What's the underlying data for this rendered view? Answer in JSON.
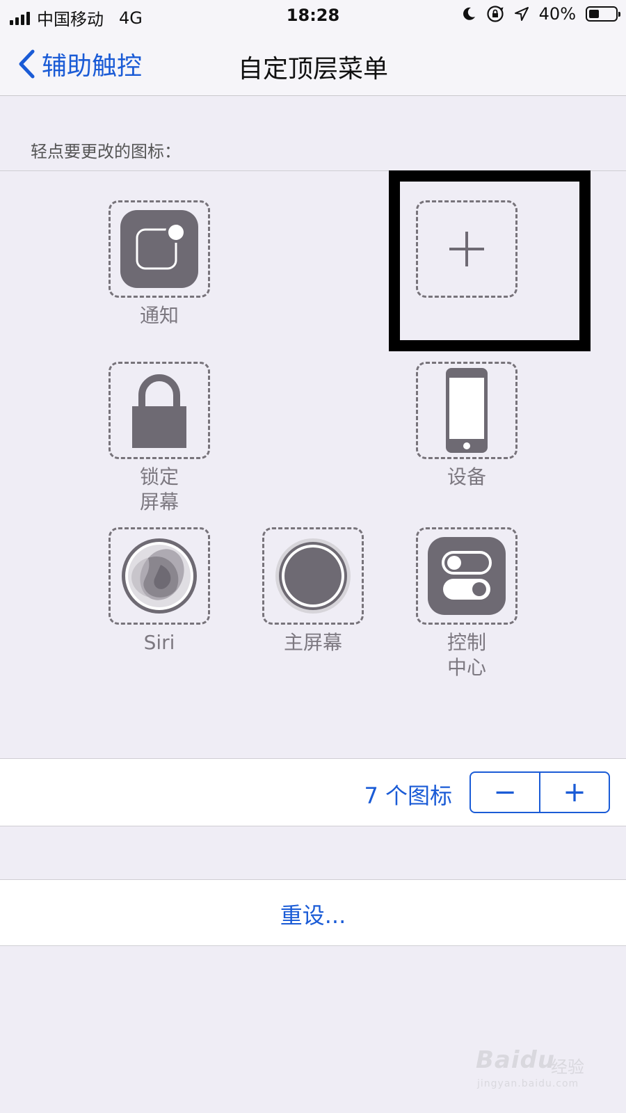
{
  "status_bar": {
    "carrier": "中国移动",
    "network": "4G",
    "time": "18:28",
    "battery_percent": "40%",
    "battery_level": 0.4,
    "icons": [
      "moon-icon",
      "rotation-lock-icon",
      "location-arrow-icon"
    ]
  },
  "nav": {
    "back_label": "辅助触控",
    "title": "自定顶层菜单"
  },
  "section_caption": "轻点要更改的图标：",
  "icons": [
    {
      "label": "通知",
      "icon": "notification-icon"
    },
    {
      "label": "",
      "icon": "plus-icon",
      "highlighted": true
    },
    {
      "label": "锁定\n屏幕",
      "icon": "lock-icon"
    },
    {
      "label": "设备",
      "icon": "device-icon"
    },
    {
      "label": "Siri",
      "icon": "siri-icon"
    },
    {
      "label": "主屏幕",
      "icon": "home-button-icon"
    },
    {
      "label": "控制\n中心",
      "icon": "control-center-icon"
    }
  ],
  "icon_count": {
    "label": "7 个图标",
    "decrement": "−",
    "increment": "+"
  },
  "reset_label": "重设...",
  "watermark": {
    "brand_left": "Bai",
    "brand_right": "du",
    "brand_suffix": "经验",
    "url": "jingyan.baidu.com"
  },
  "colors": {
    "accent": "#1a5bd6",
    "icon_fill": "#6e6a73",
    "background": "#efedf5"
  }
}
